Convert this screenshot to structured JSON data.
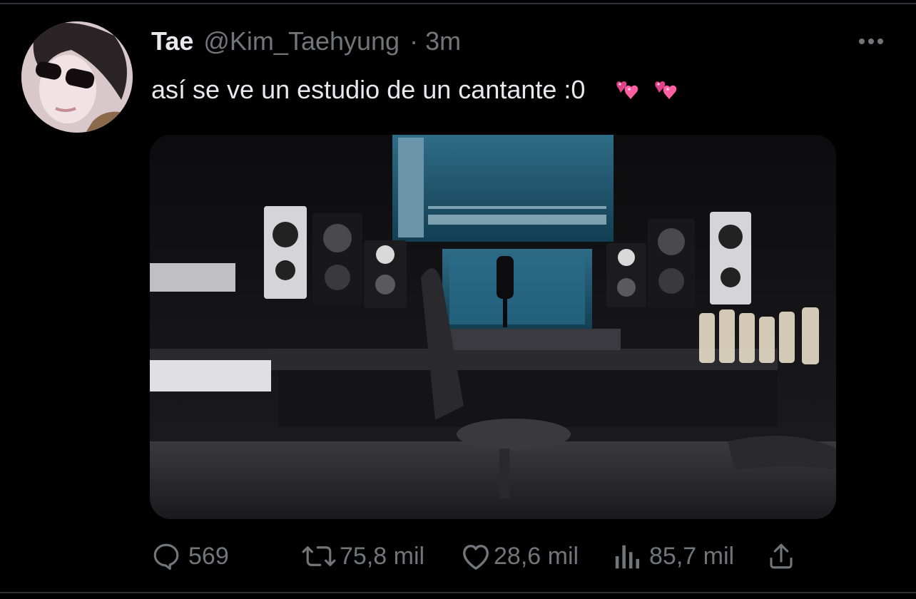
{
  "tweet": {
    "display_name": "Tae",
    "handle": "@Kim_Taehyung",
    "separator": "·",
    "time": "3m",
    "text": "así se ve un estudio de un cantante :0",
    "emojis": [
      "two-hearts-emoji",
      "two-hearts-emoji"
    ],
    "media": {
      "type": "photo",
      "scene": "music-studio"
    }
  },
  "actions": {
    "replies": "569",
    "retweets": "75,8 mil",
    "likes": "28,6 mil",
    "views": "85,7 mil"
  },
  "icons": {
    "more": "more-horizontal-icon",
    "reply": "reply-icon",
    "retweet": "retweet-icon",
    "like": "heart-icon",
    "views": "views-chart-icon",
    "share": "share-icon"
  },
  "colors": {
    "background": "#000000",
    "text": "#e7e9ea",
    "secondary": "#71767b",
    "emoji_pink": "#e0428a"
  }
}
